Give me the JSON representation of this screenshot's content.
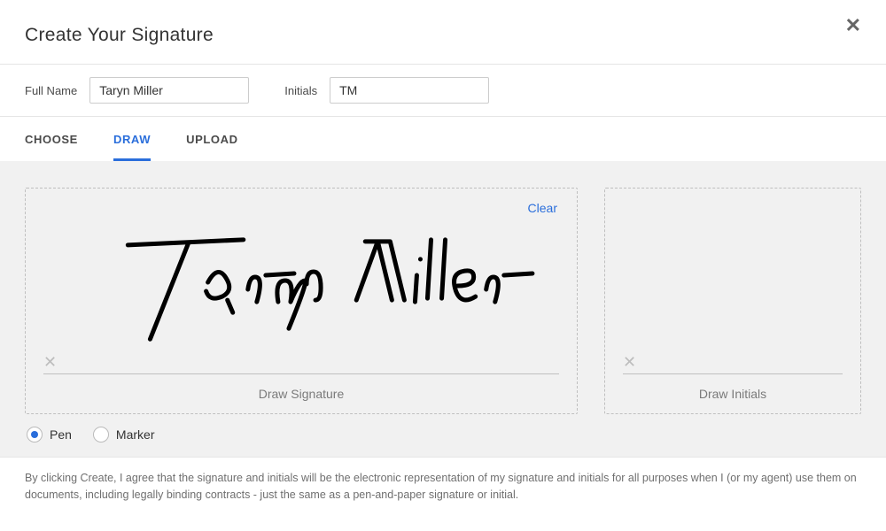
{
  "header": {
    "title": "Create Your Signature"
  },
  "form": {
    "full_name_label": "Full Name",
    "full_name_value": "Taryn Miller",
    "initials_label": "Initials",
    "initials_value": "TM"
  },
  "tabs": {
    "choose": "CHOOSE",
    "draw": "DRAW",
    "upload": "UPLOAD",
    "active": "draw"
  },
  "signature": {
    "clear_label": "Clear",
    "signature_caption": "Draw Signature",
    "initials_caption": "Draw Initials",
    "drawn_text_preview": "Taryn Miller"
  },
  "tools": {
    "pen_label": "Pen",
    "marker_label": "Marker",
    "selected": "pen"
  },
  "disclaimer": "By clicking Create, I agree that the signature and initials will be the electronic representation of my signature and initials for all purposes when I (or my agent) use them on documents, including legally binding contracts - just the same as a pen-and-paper signature or initial."
}
